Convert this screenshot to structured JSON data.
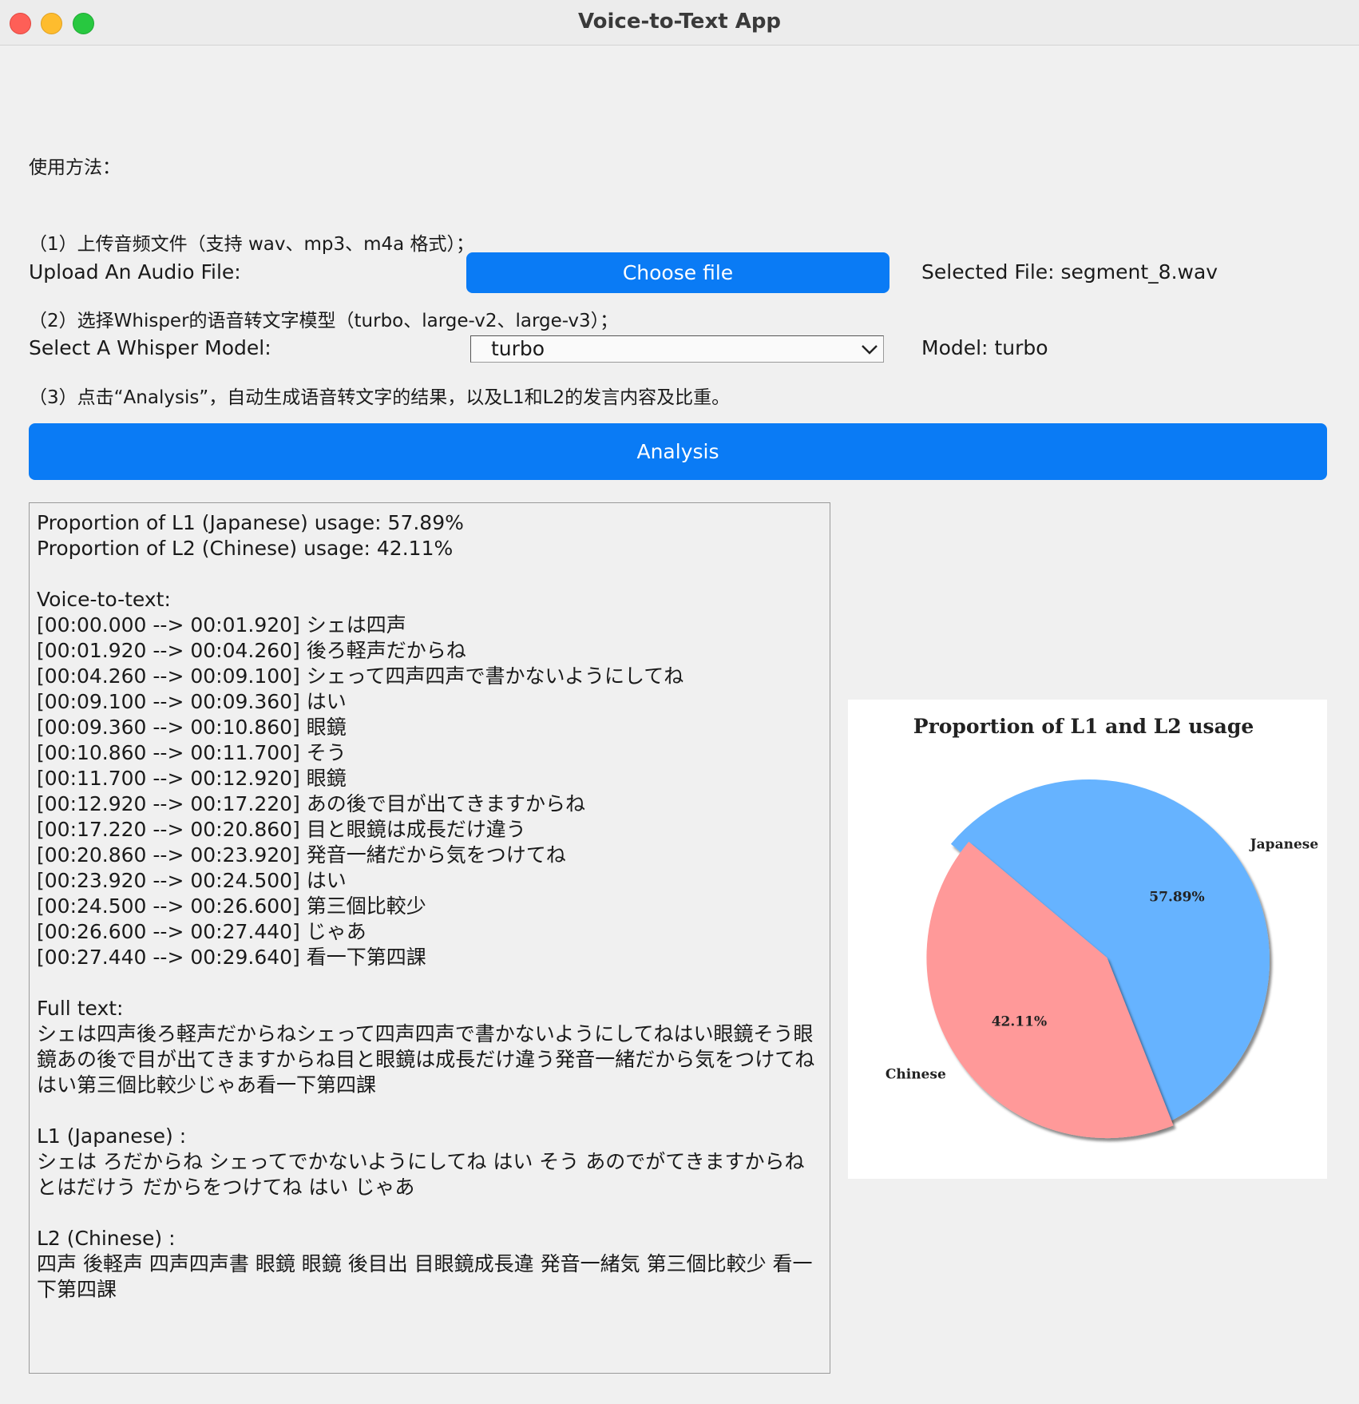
{
  "window": {
    "title": "Voice-to-Text App"
  },
  "instructions": {
    "heading": "使用方法：",
    "steps": [
      "（1）上传音频文件（支持 wav、mp3、m4a 格式）；",
      "（2）选择Whisper的语音转文字模型（turbo、large-v2、large-v3）；",
      "（3）点击“Analysis”，自动生成语音转文字的结果，以及L1和L2的发言内容及比重。"
    ]
  },
  "upload": {
    "label": "Upload An Audio File:",
    "button_label": "Choose file",
    "selected_text": "Selected File: segment_8.wav"
  },
  "model": {
    "label": "Select A Whisper Model:",
    "selected": "turbo",
    "status_text": "Model: turbo"
  },
  "analysis": {
    "button_label": "Analysis"
  },
  "results": {
    "l1_proportion": "Proportion of L1 (Japanese) usage: 57.89%",
    "l2_proportion": "Proportion of L2 (Chinese) usage: 42.11%",
    "vtt_heading": "Voice-to-text:",
    "segments": [
      "[00:00.000 --> 00:01.920] シェは四声",
      "[00:01.920 --> 00:04.260] 後ろ軽声だからね",
      "[00:04.260 --> 00:09.100] シェって四声四声で書かないようにしてね",
      "[00:09.100 --> 00:09.360] はい",
      "[00:09.360 --> 00:10.860] 眼鏡",
      "[00:10.860 --> 00:11.700] そう",
      "[00:11.700 --> 00:12.920] 眼鏡",
      "[00:12.920 --> 00:17.220] あの後で目が出てきますからね",
      "[00:17.220 --> 00:20.860] 目と眼鏡は成長だけ違う",
      "[00:20.860 --> 00:23.920] 発音一緒だから気をつけてね",
      "[00:23.920 --> 00:24.500] はい",
      "[00:24.500 --> 00:26.600] 第三個比較少",
      "[00:26.600 --> 00:27.440] じゃあ",
      "[00:27.440 --> 00:29.640] 看一下第四課"
    ],
    "full_heading": "Full text:",
    "full_text": "シェは四声後ろ軽声だからねシェって四声四声で書かないようにしてねはい眼鏡そう眼鏡あの後で目が出てきますからね目と眼鏡は成長だけ違う発音一緒だから気をつけてねはい第三個比較少じゃあ看一下第四課",
    "l1_heading": "L1 (Japanese) :",
    "l1_text": "シェは ろだからね シェってでかないようにしてね はい そう あのでがてきますからね とはだけう だからをつけてね はい じゃあ",
    "l2_heading": "L2 (Chinese) :",
    "l2_text": "四声 後軽声 四声四声書 眼鏡 眼鏡 後目出 目眼鏡成長違 発音一緒気 第三個比較少 看一下第四課"
  },
  "chart_data": {
    "type": "pie",
    "title": "Proportion of L1 and L2 usage",
    "categories": [
      "Japanese",
      "Chinese"
    ],
    "values": [
      57.89,
      42.11
    ],
    "value_labels": [
      "57.89%",
      "42.11%"
    ],
    "colors": [
      "#66b3ff",
      "#ff9999"
    ],
    "explode": [
      0,
      0.1
    ],
    "shadow": true
  }
}
